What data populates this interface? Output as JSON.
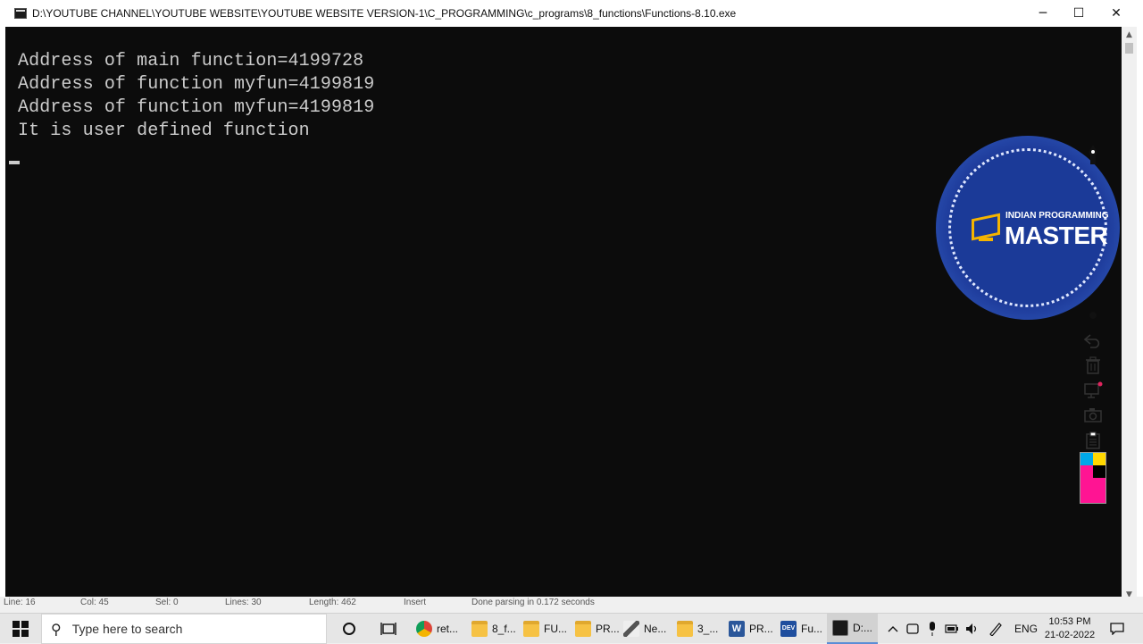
{
  "window": {
    "title": "D:\\YOUTUBE CHANNEL\\YOUTUBE WEBSITE\\YOUTUBE WEBSITE VERSION-1\\C_PROGRAMMING\\c_programs\\8_functions\\Functions-8.10.exe",
    "minimize": "─",
    "maximize": "☐",
    "close": "✕"
  },
  "console": {
    "lines": [
      "Address of main function=4199728",
      "Address of function myfun=4199819",
      "Address of function myfun=4199819",
      "It is user defined function"
    ],
    "text_color": "#cccccc",
    "background": "#0c0c0c"
  },
  "statusbar": {
    "line": "Line: 16",
    "col": "Col: 45",
    "sel": "Sel: 0",
    "lines": "Lines: 30",
    "length": "Length: 462",
    "mode": "Insert",
    "message": "Done parsing in 0.172 seconds"
  },
  "logo": {
    "line1": "INDIAN PROGRAMMING",
    "line2": "MASTER",
    "brand_color": "#1b3a98",
    "accent_color": "#f5b400"
  },
  "tools": {
    "icons": [
      "pen-tip-icon",
      "dot-icon",
      "undo-icon",
      "trash-icon",
      "screen-icon",
      "camera-icon",
      "clipboard-icon"
    ]
  },
  "palette": {
    "colors": [
      "#00a8e8",
      "#ffd800",
      "#ff1493",
      "#000000"
    ]
  },
  "taskbar": {
    "search_placeholder": "Type here to search",
    "apps": [
      {
        "label": "ret...",
        "icon": "chrome-icon"
      },
      {
        "label": "8_f...",
        "icon": "folder-icon"
      },
      {
        "label": "FU...",
        "icon": "folder-icon"
      },
      {
        "label": "PR...",
        "icon": "folder-icon"
      },
      {
        "label": "Ne...",
        "icon": "pen-icon"
      },
      {
        "label": "3_...",
        "icon": "folder-icon"
      },
      {
        "label": "PR...",
        "icon": "word-icon"
      },
      {
        "label": "Fu...",
        "icon": "devcpp-icon"
      },
      {
        "label": "D:...",
        "icon": "console-icon"
      }
    ],
    "language": "ENG",
    "time": "10:53 PM",
    "date": "21-02-2022"
  }
}
